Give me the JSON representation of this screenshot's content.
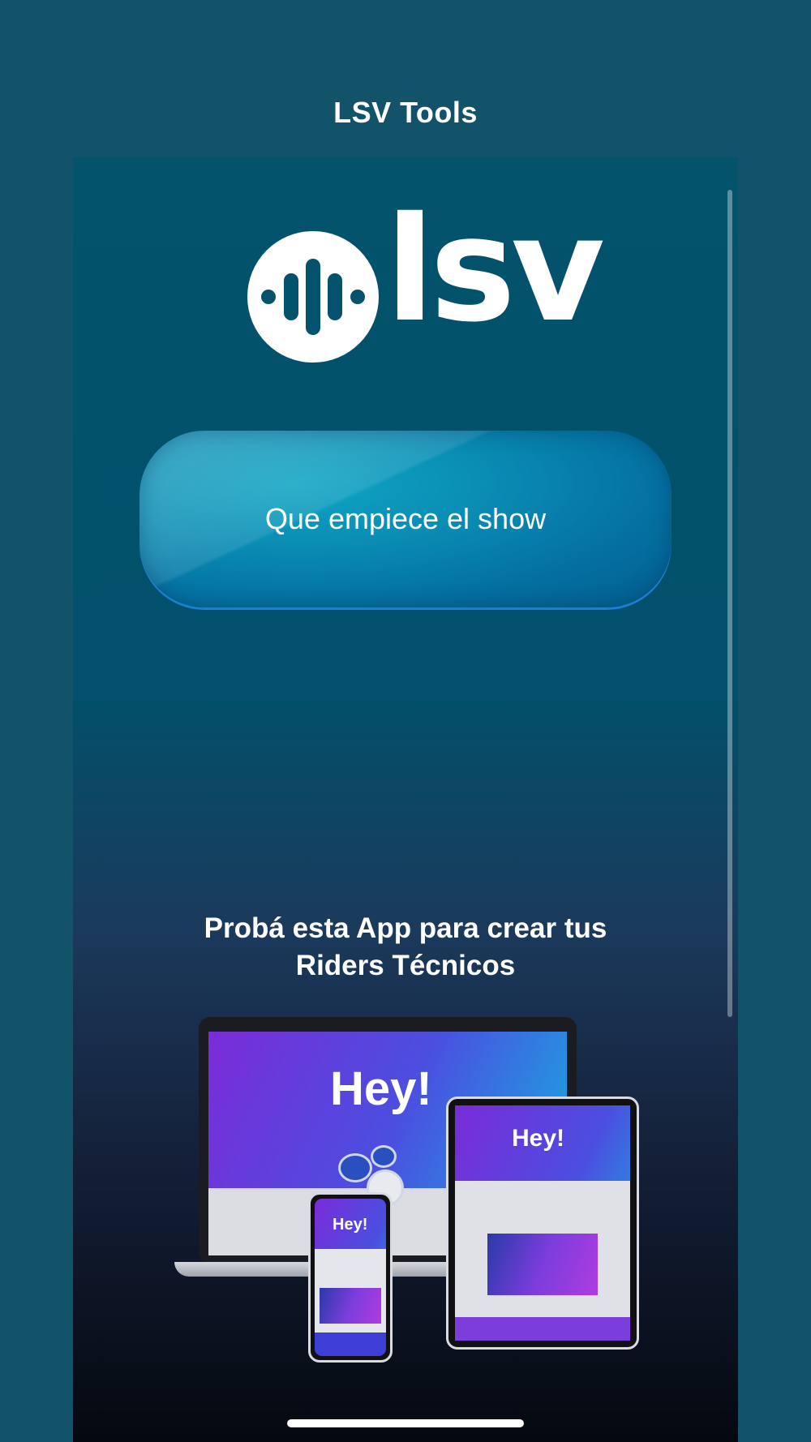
{
  "nav": {
    "title": "LSV Tools"
  },
  "logo": {
    "text": "lsv",
    "icon": "sound-wave-icon"
  },
  "cta": {
    "label": "Que empiece el show"
  },
  "promo": {
    "line1": "Probá esta App para crear tus",
    "line2": "Riders Técnicos"
  },
  "illustration": {
    "laptop_heading": "Hey!",
    "tablet_heading": "Hey!",
    "phone_heading": "Hey!"
  },
  "colors": {
    "background": "#12536a",
    "panel_top": "#03536c",
    "cta": "#0a8db4",
    "text": "#ffffff"
  }
}
